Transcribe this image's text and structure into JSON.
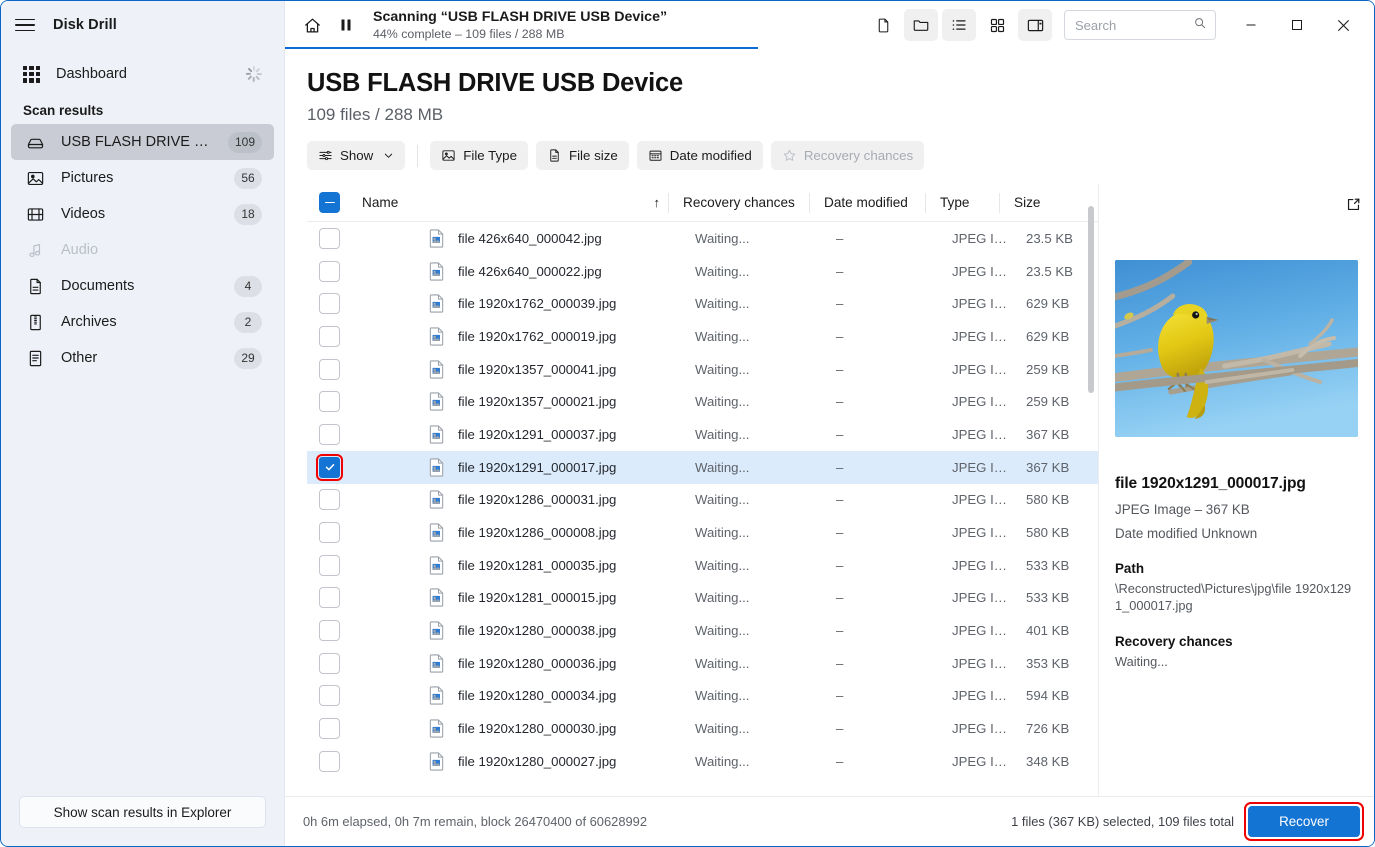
{
  "sidebar": {
    "app_title": "Disk Drill",
    "hamburger_icon": "hamburger-menu-icon",
    "dashboard": {
      "label": "Dashboard",
      "icon": "grid-icon",
      "status_icon": "loading-spinner-icon"
    },
    "section_label": "Scan results",
    "items": [
      {
        "label": "USB FLASH DRIVE USB…",
        "badge": "109",
        "icon": "disk-drive-icon",
        "active": true,
        "disabled": false
      },
      {
        "label": "Pictures",
        "badge": "56",
        "icon": "image-icon",
        "active": false,
        "disabled": false
      },
      {
        "label": "Videos",
        "badge": "18",
        "icon": "film-icon",
        "active": false,
        "disabled": false
      },
      {
        "label": "Audio",
        "badge": "",
        "icon": "music-note-icon",
        "active": false,
        "disabled": true
      },
      {
        "label": "Documents",
        "badge": "4",
        "icon": "document-icon",
        "active": false,
        "disabled": false
      },
      {
        "label": "Archives",
        "badge": "2",
        "icon": "archive-icon",
        "active": false,
        "disabled": false
      },
      {
        "label": "Other",
        "badge": "29",
        "icon": "list-document-icon",
        "active": false,
        "disabled": false
      }
    ],
    "footer_button": "Show scan results in Explorer"
  },
  "titlebar": {
    "home_icon": "home-icon",
    "pause_icon": "pause-icon",
    "scan_title": "Scanning “USB FLASH DRIVE USB Device”",
    "scan_subtitle": "44% complete – 109 files / 288 MB",
    "progress_percent": 44,
    "progress_color": "#0b6bdb",
    "tools": [
      {
        "name": "new-file-icon",
        "active": false
      },
      {
        "name": "folder-icon",
        "active": true
      },
      {
        "name": "list-view-icon",
        "active": true
      },
      {
        "name": "grid-view-icon",
        "active": false
      },
      {
        "name": "preview-panel-icon",
        "active": true
      }
    ],
    "search_placeholder": "Search",
    "search_value": "",
    "search_icon": "search-icon",
    "window_minimize": "minimize-icon",
    "window_maximize": "maximize-icon",
    "window_close": "close-icon"
  },
  "header": {
    "title": "USB FLASH DRIVE USB Device",
    "subtitle": "109 files / 288 MB"
  },
  "filters": [
    {
      "label": "Show",
      "icon": "sliders-icon",
      "caret": true,
      "dim": false
    },
    {
      "label": "File Type",
      "icon": "image-icon",
      "caret": false,
      "dim": false
    },
    {
      "label": "File size",
      "icon": "document-icon",
      "caret": false,
      "dim": false
    },
    {
      "label": "Date modified",
      "icon": "calendar-icon",
      "caret": false,
      "dim": false
    },
    {
      "label": "Recovery chances",
      "icon": "star-icon",
      "caret": false,
      "dim": true
    }
  ],
  "table": {
    "select_all_state": "indeterminate",
    "sort_column": "Name",
    "sort_direction": "asc",
    "sort_arrow": "↑",
    "columns": [
      "Name",
      "Recovery chances",
      "Date modified",
      "Type",
      "Size"
    ],
    "rows": [
      {
        "name": "file 426x640_000042.jpg",
        "recovery": "Waiting...",
        "date": "–",
        "type": "JPEG Im…",
        "size": "23.5 KB",
        "checked": false,
        "selected": false
      },
      {
        "name": "file 426x640_000022.jpg",
        "recovery": "Waiting...",
        "date": "–",
        "type": "JPEG Im…",
        "size": "23.5 KB",
        "checked": false,
        "selected": false
      },
      {
        "name": "file 1920x1762_000039.jpg",
        "recovery": "Waiting...",
        "date": "–",
        "type": "JPEG Im…",
        "size": "629 KB",
        "checked": false,
        "selected": false
      },
      {
        "name": "file 1920x1762_000019.jpg",
        "recovery": "Waiting...",
        "date": "–",
        "type": "JPEG Im…",
        "size": "629 KB",
        "checked": false,
        "selected": false
      },
      {
        "name": "file 1920x1357_000041.jpg",
        "recovery": "Waiting...",
        "date": "–",
        "type": "JPEG Im…",
        "size": "259 KB",
        "checked": false,
        "selected": false
      },
      {
        "name": "file 1920x1357_000021.jpg",
        "recovery": "Waiting...",
        "date": "–",
        "type": "JPEG Im…",
        "size": "259 KB",
        "checked": false,
        "selected": false
      },
      {
        "name": "file 1920x1291_000037.jpg",
        "recovery": "Waiting...",
        "date": "–",
        "type": "JPEG Im…",
        "size": "367 KB",
        "checked": false,
        "selected": false
      },
      {
        "name": "file 1920x1291_000017.jpg",
        "recovery": "Waiting...",
        "date": "–",
        "type": "JPEG Im…",
        "size": "367 KB",
        "checked": true,
        "selected": true
      },
      {
        "name": "file 1920x1286_000031.jpg",
        "recovery": "Waiting...",
        "date": "–",
        "type": "JPEG Im…",
        "size": "580 KB",
        "checked": false,
        "selected": false
      },
      {
        "name": "file 1920x1286_000008.jpg",
        "recovery": "Waiting...",
        "date": "–",
        "type": "JPEG Im…",
        "size": "580 KB",
        "checked": false,
        "selected": false
      },
      {
        "name": "file 1920x1281_000035.jpg",
        "recovery": "Waiting...",
        "date": "–",
        "type": "JPEG Im…",
        "size": "533 KB",
        "checked": false,
        "selected": false
      },
      {
        "name": "file 1920x1281_000015.jpg",
        "recovery": "Waiting...",
        "date": "–",
        "type": "JPEG Im…",
        "size": "533 KB",
        "checked": false,
        "selected": false
      },
      {
        "name": "file 1920x1280_000038.jpg",
        "recovery": "Waiting...",
        "date": "–",
        "type": "JPEG Im…",
        "size": "401 KB",
        "checked": false,
        "selected": false
      },
      {
        "name": "file 1920x1280_000036.jpg",
        "recovery": "Waiting...",
        "date": "–",
        "type": "JPEG Im…",
        "size": "353 KB",
        "checked": false,
        "selected": false
      },
      {
        "name": "file 1920x1280_000034.jpg",
        "recovery": "Waiting...",
        "date": "–",
        "type": "JPEG Im…",
        "size": "594 KB",
        "checked": false,
        "selected": false
      },
      {
        "name": "file 1920x1280_000030.jpg",
        "recovery": "Waiting...",
        "date": "–",
        "type": "JPEG Im…",
        "size": "726 KB",
        "checked": false,
        "selected": false
      },
      {
        "name": "file 1920x1280_000027.jpg",
        "recovery": "Waiting...",
        "date": "–",
        "type": "JPEG Im…",
        "size": "348 KB",
        "checked": false,
        "selected": false
      }
    ]
  },
  "preview": {
    "open_external_icon": "open-external-icon",
    "image_alt": "yellow bird perched on bare branch against blue sky",
    "file_name": "file 1920x1291_000017.jpg",
    "file_meta": "JPEG Image – 367 KB",
    "date_modified": "Date modified Unknown",
    "path_label": "Path",
    "path_value": "\\Reconstructed\\Pictures\\jpg\\file 1920x1291_000017.jpg",
    "recovery_label": "Recovery chances",
    "recovery_value": "Waiting..."
  },
  "statusbar": {
    "left": "0h 6m elapsed, 0h 7m remain, block 26470400 of 60628992",
    "right": "1 files (367 KB) selected, 109 files total",
    "recover_button": "Recover",
    "highlight_color": "#f00000"
  }
}
